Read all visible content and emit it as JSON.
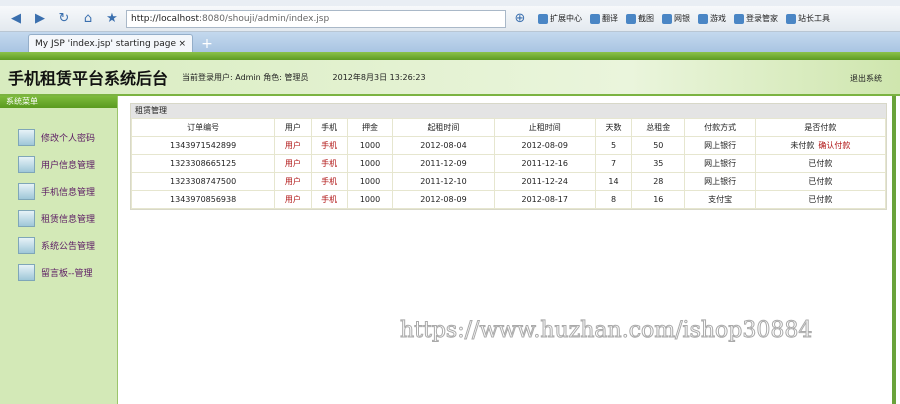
{
  "browser": {
    "url_host": "http://localhost",
    "url_rest": ":8080/shouji/admin/index.jsp",
    "tab_title": "My JSP 'index.jsp' starting page",
    "tools": [
      "扩展中心",
      "翻译",
      "截图",
      "网银",
      "游戏",
      "登录管家",
      "站长工具"
    ]
  },
  "header": {
    "title": "手机租赁平台系统后台",
    "user_info": "当前登录用户: Admin 角色: 管理员",
    "datetime": "2012年8月3日 13:26:23",
    "logout": "退出系统"
  },
  "sidebar": {
    "heading": "系统菜单",
    "items": [
      {
        "label": "修改个人密码"
      },
      {
        "label": "用户信息管理"
      },
      {
        "label": "手机信息管理"
      },
      {
        "label": "租赁信息管理"
      },
      {
        "label": "系统公告管理"
      },
      {
        "label": "留言板--管理"
      }
    ]
  },
  "panel": {
    "title": "租赁管理",
    "columns": [
      "订单编号",
      "用户",
      "手机",
      "押金",
      "起租时间",
      "止租时间",
      "天数",
      "总租金",
      "付款方式",
      "是否付款"
    ],
    "rows": [
      {
        "id": "1343971542899",
        "user": "用户",
        "phone": "手机",
        "deposit": "1000",
        "start": "2012-08-04",
        "end": "2012-08-09",
        "days": "5",
        "total": "50",
        "method": "网上银行",
        "paid": "未付款",
        "action": "确认付款"
      },
      {
        "id": "1323308665125",
        "user": "用户",
        "phone": "手机",
        "deposit": "1000",
        "start": "2011-12-09",
        "end": "2011-12-16",
        "days": "7",
        "total": "35",
        "method": "网上银行",
        "paid": "已付款"
      },
      {
        "id": "1323308747500",
        "user": "用户",
        "phone": "手机",
        "deposit": "1000",
        "start": "2011-12-10",
        "end": "2011-12-24",
        "days": "14",
        "total": "28",
        "method": "网上银行",
        "paid": "已付款"
      },
      {
        "id": "1343970856938",
        "user": "用户",
        "phone": "手机",
        "deposit": "1000",
        "start": "2012-08-09",
        "end": "2012-08-17",
        "days": "8",
        "total": "16",
        "method": "支付宝",
        "paid": "已付款"
      }
    ]
  },
  "watermark": "https://www.huzhan.com/ishop30884"
}
